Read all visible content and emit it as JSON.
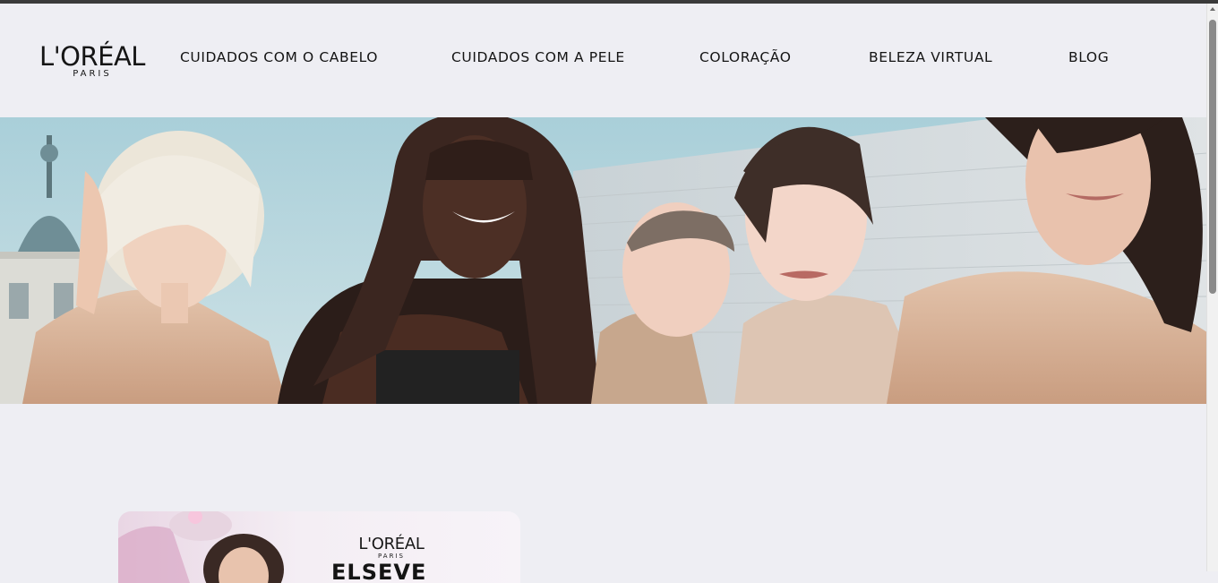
{
  "brand": {
    "name": "L'ORÉAL",
    "sub": "PARIS"
  },
  "nav": [
    {
      "label": "CUIDADOS COM O CABELO"
    },
    {
      "label": "CUIDADOS COM A PELE"
    },
    {
      "label": "COLORAÇÃO"
    },
    {
      "label": "BELEZA VIRTUAL"
    },
    {
      "label": "BLOG"
    }
  ],
  "hero": {
    "image": "five-models-banner"
  },
  "promo": {
    "brand": "L'ORÉAL",
    "sub": "PARIS",
    "product": "ELSEVE"
  },
  "colors": {
    "background": "#eeeef3",
    "text": "#141414",
    "accent_skin": "#d8b49a"
  }
}
